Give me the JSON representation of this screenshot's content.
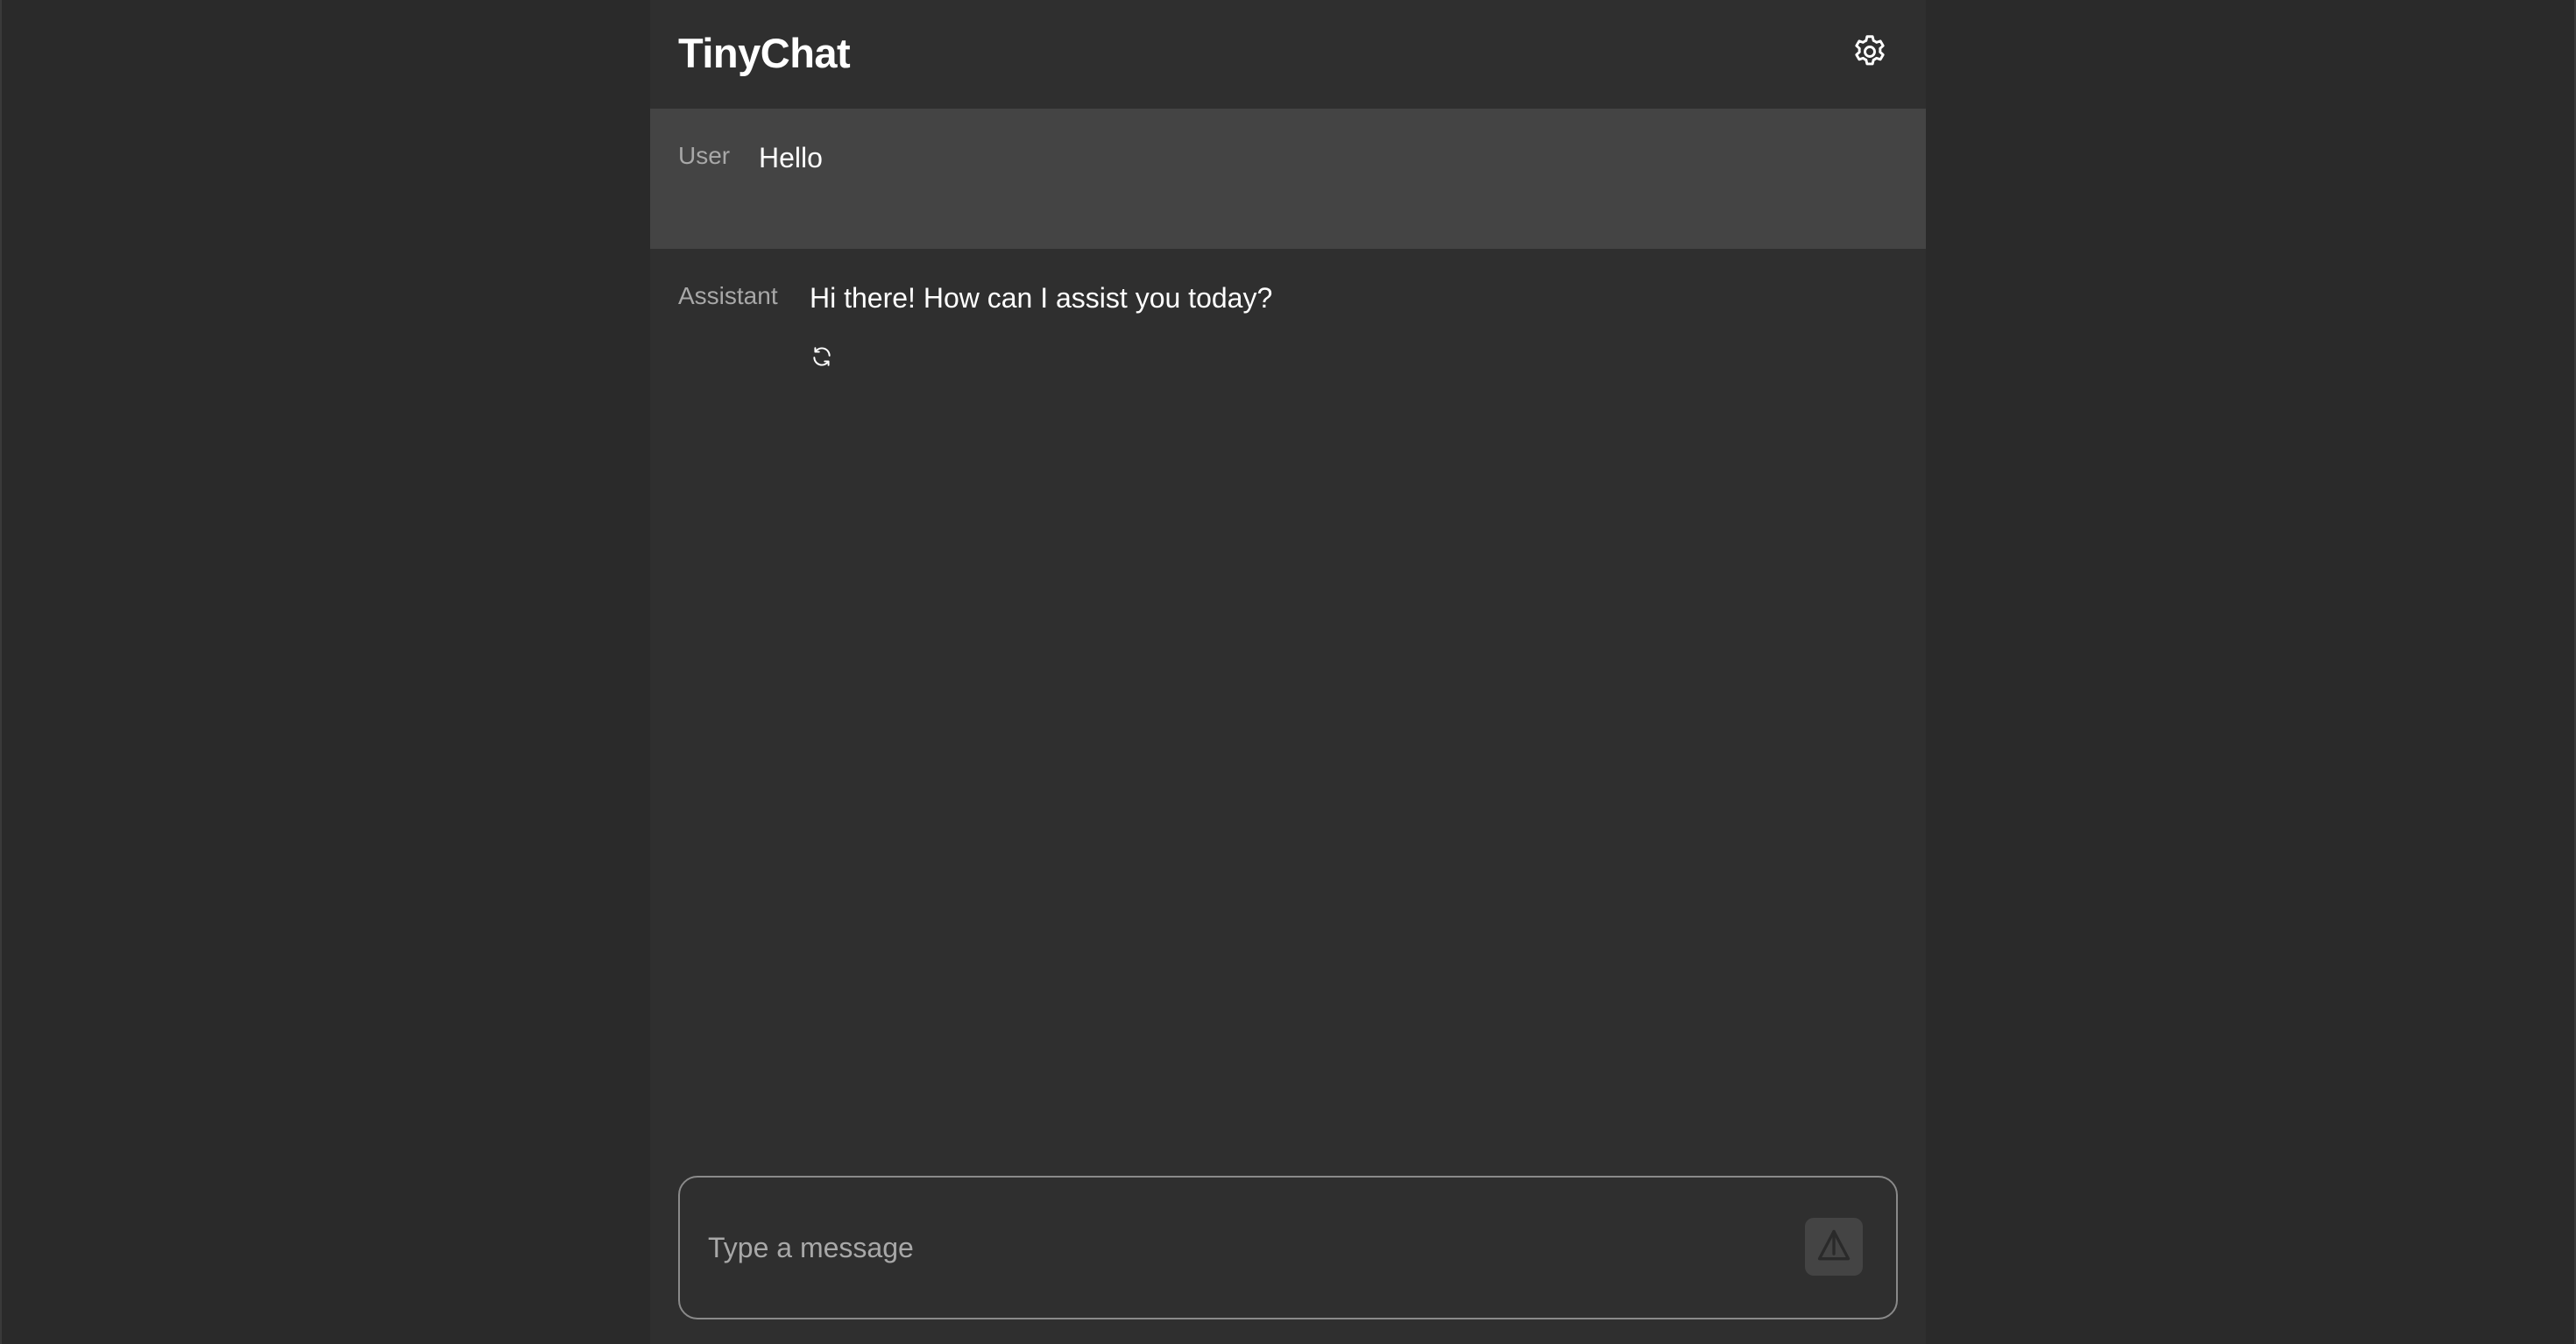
{
  "header": {
    "title": "TinyChat",
    "settings_icon": "gear-icon"
  },
  "messages": [
    {
      "role": "User",
      "text": "Hello"
    },
    {
      "role": "Assistant",
      "text": "Hi there! How can I assist you today?",
      "action_icon": "refresh-icon"
    }
  ],
  "composer": {
    "value": "",
    "placeholder": "Type a message",
    "send_icon": "send-icon"
  },
  "colors": {
    "page_background": "#2a2a2a",
    "app_background": "#2f2f2f",
    "user_message_background": "#444444",
    "label_text": "#a8a8a8",
    "text": "#ffffff",
    "composer_border": "#8a8a8a"
  }
}
